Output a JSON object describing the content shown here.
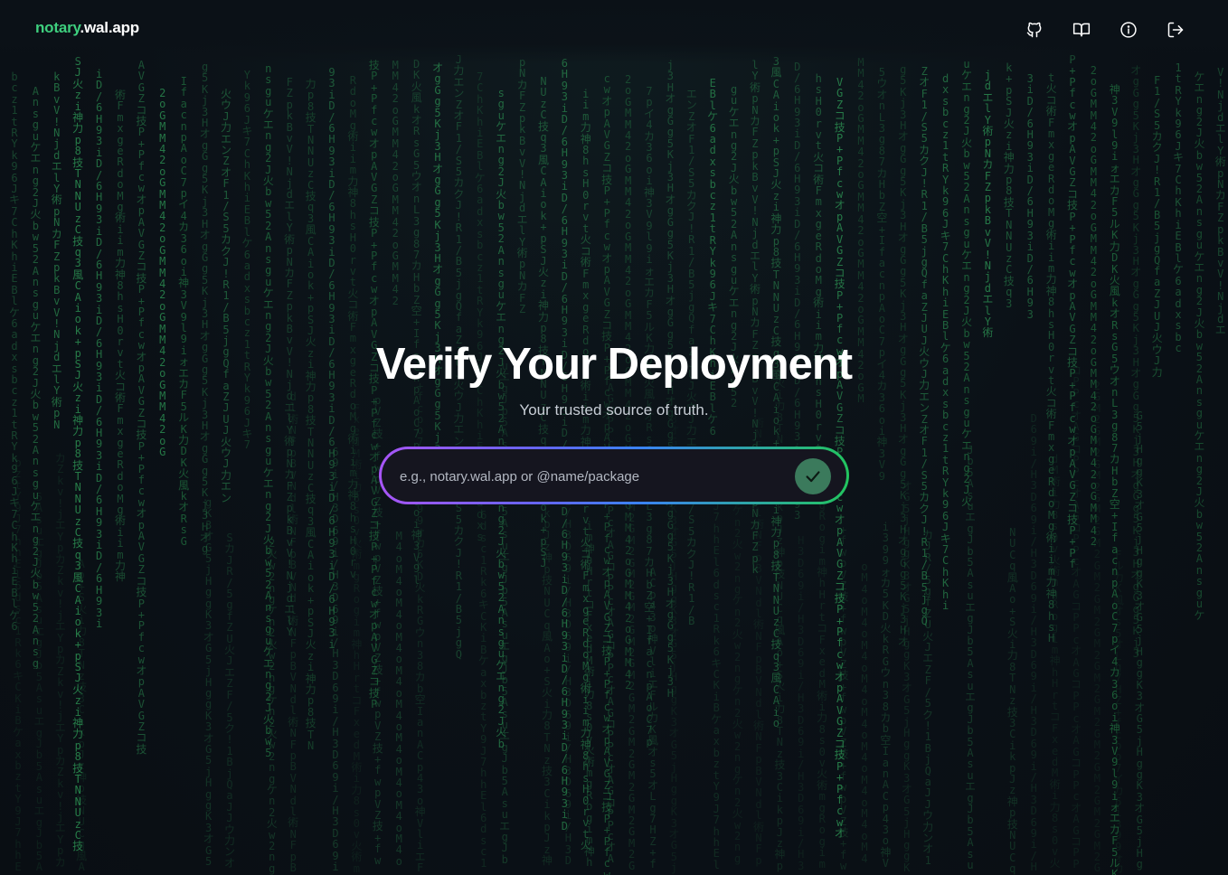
{
  "header": {
    "logo_accent": "notary",
    "logo_rest": ".wal.app",
    "icons": [
      "github-icon",
      "book-icon",
      "info-icon",
      "logout-icon"
    ]
  },
  "hero": {
    "title": "Verify Your Deployment",
    "subtitle": "Your trusted source of truth."
  },
  "search": {
    "placeholder": "e.g., notary.wal.app or @name/package",
    "submit_icon": "check-icon"
  },
  "colors": {
    "background": "#0b1117",
    "accent": "#3ecf7e",
    "rain": "#2a8a4f",
    "submit_button": "#3b7a5c",
    "gradient": [
      "#a855f7",
      "#6366f1",
      "#3b82f6",
      "#22c55e"
    ]
  },
  "rain": {
    "columns": [
      "bcz1tRYk96Jキ7ChKhiEBlケ6adxs",
      "w52Ansguケエng2J火b",
      "pNカFZpkBvV!NjdエlY術",
      "3風CAiok+pSJ火zi神力p8技TNNUzC技q",
      "/6H93iD",
      "iim力神8hsH0rvt火コ術FmxgeRdoMg術",
      "cwオpAVGZコ技P+Pf",
      "MM42oG",
      "DK火風kオRsG5ウオnL3g87カHbZ空+IfacnpAoC7pイ4カ36oi神3V9l9iォエカF5ルK力",
      "g5Kj3HオgG",
      "ウJ力エンZオF1/S5カクJ!R1/B5jgQfaZJUJ火"
    ]
  }
}
